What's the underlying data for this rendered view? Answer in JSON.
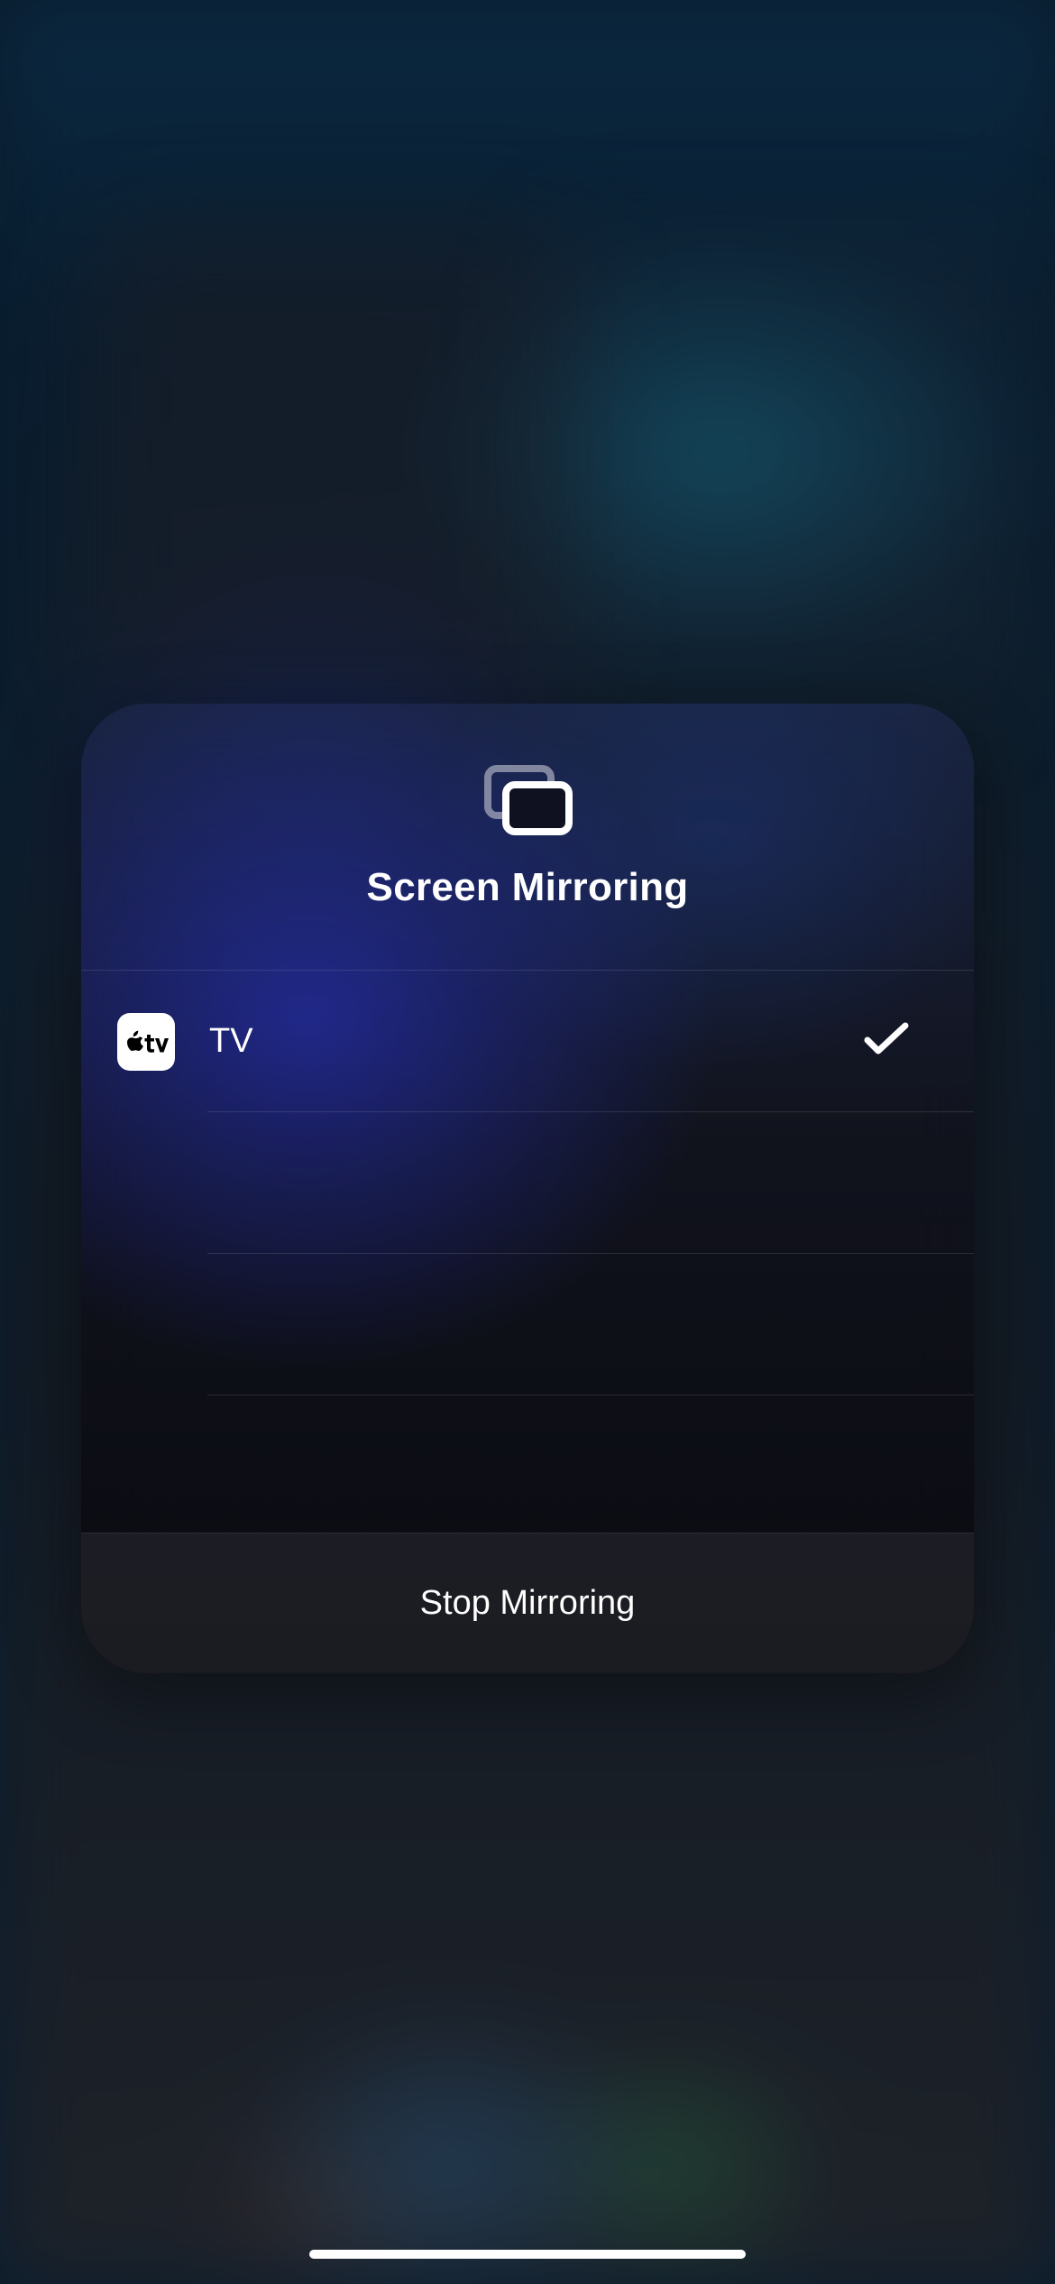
{
  "modal": {
    "title": "Screen Mirroring",
    "header_icon": "screen-mirroring-icon",
    "devices": [
      {
        "name": "TV",
        "icon": "apple-tv-icon",
        "selected": true
      },
      {
        "name": "",
        "icon": null,
        "selected": false
      },
      {
        "name": "",
        "icon": null,
        "selected": false
      },
      {
        "name": "",
        "icon": null,
        "selected": false
      }
    ],
    "footer_label": "Stop Mirroring"
  }
}
